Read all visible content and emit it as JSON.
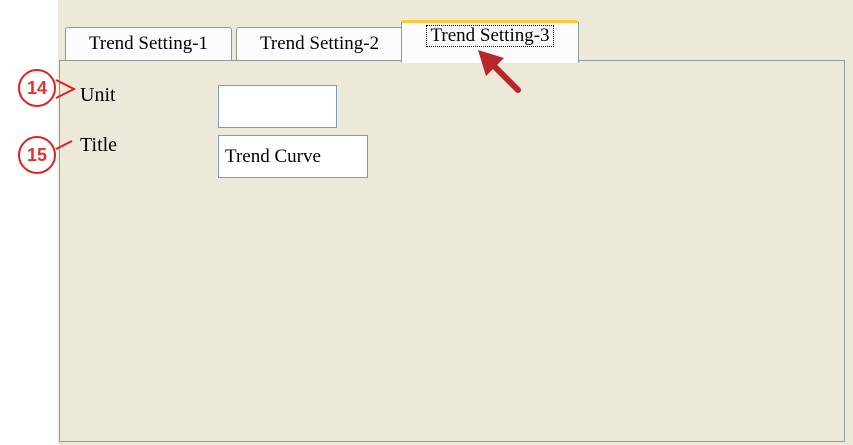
{
  "tabs": [
    {
      "label": "Trend Setting-1",
      "active": false
    },
    {
      "label": "Trend Setting-2",
      "active": false
    },
    {
      "label": "Trend Setting-3",
      "active": true
    }
  ],
  "fields": {
    "unit": {
      "label": "Unit",
      "value": ""
    },
    "title": {
      "label": "Title",
      "value": "Trend Curve"
    }
  },
  "callouts": {
    "unit": "14",
    "title": "15"
  },
  "colors": {
    "callout": "#e02020",
    "arrow": "#b8252a",
    "active_tab_highlight": "#ffc83c",
    "dialog_background": "#ece9d8"
  },
  "icons": {
    "pointer": "arrow-pointer-icon"
  }
}
